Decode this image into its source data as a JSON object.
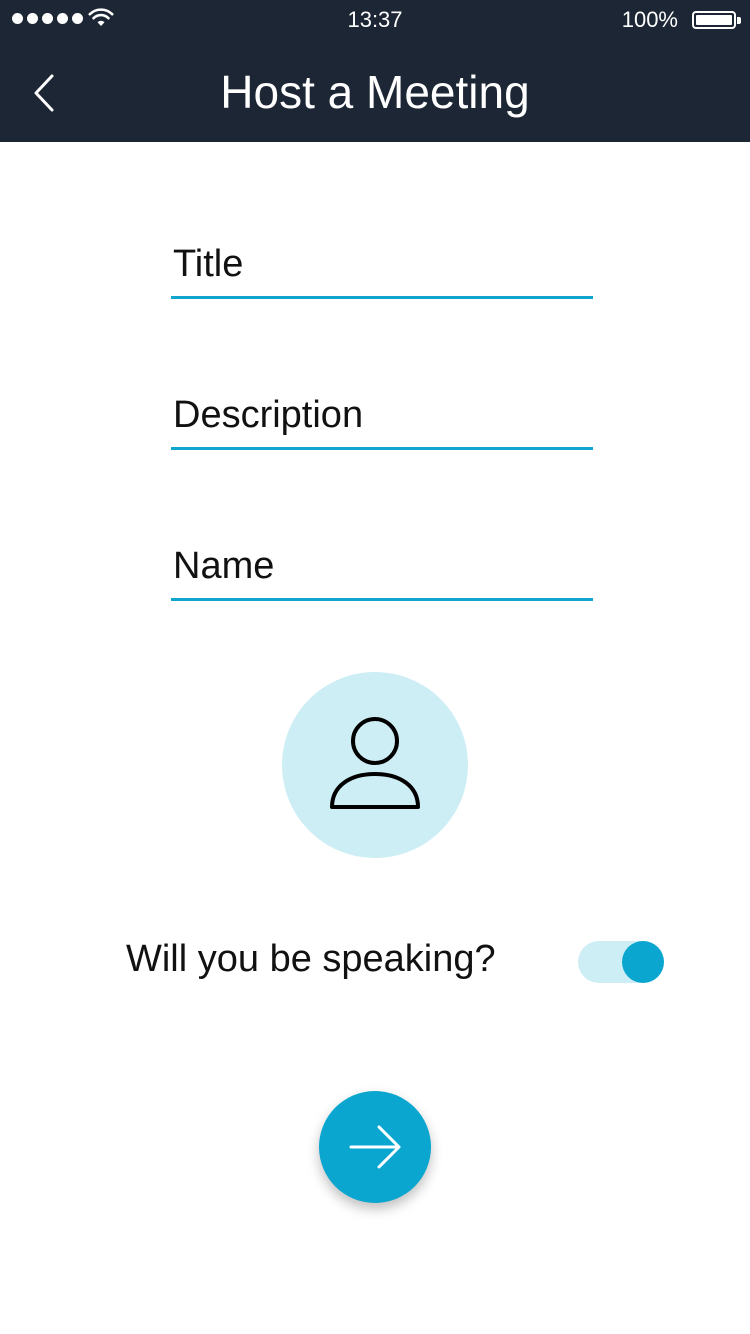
{
  "status_bar": {
    "time": "13:37",
    "battery": "100%",
    "signal_icon": "signal-dots-icon",
    "wifi_icon": "wifi-icon",
    "battery_icon": "battery-icon"
  },
  "header": {
    "title": "Host a Meeting",
    "back_icon": "chevron-left-icon",
    "background": "#1d2634"
  },
  "form": {
    "title_placeholder": "Title",
    "description_placeholder": "Description",
    "name_placeholder": "Name",
    "accent": "#0fa5cf"
  },
  "avatar": {
    "icon": "user-icon",
    "background": "#cdeef5"
  },
  "speaking": {
    "label": "Will you be speaking?",
    "toggle_on": true
  },
  "next_button": {
    "icon": "arrow-right-icon",
    "color": "#0aa6cf"
  }
}
